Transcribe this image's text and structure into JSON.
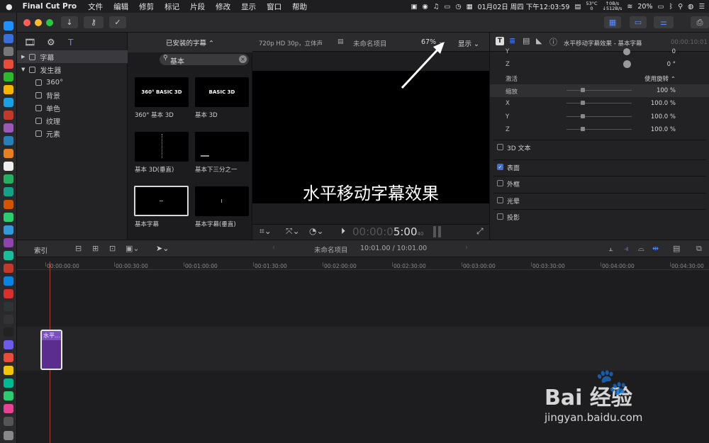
{
  "menubar": {
    "app": "Final Cut Pro",
    "items": [
      "文件",
      "编辑",
      "修剪",
      "标记",
      "片段",
      "修改",
      "显示",
      "窗口",
      "帮助"
    ],
    "datetime": "01月02日 周四 下午12:03:59",
    "battery": "20%",
    "cpu_temp": "53°C",
    "cpu_num": "0",
    "net_up": "↑0B/s",
    "net_down": "↓512B/s"
  },
  "libraries": {
    "dropdown": "已安装的字幕",
    "items": [
      "字幕",
      "发生器",
      "360°",
      "背景",
      "单色",
      "纹理",
      "元素"
    ]
  },
  "browser": {
    "search_value": "基本",
    "thumbs": [
      {
        "label": "360° 基本 3D",
        "preview": "360° BASIC 3D"
      },
      {
        "label": "基本 3D",
        "preview": "BASIC 3D"
      },
      {
        "label": "基本 3D(垂直)",
        "preview": ""
      },
      {
        "label": "基本下三分之一",
        "preview": ""
      },
      {
        "label": "基本字幕",
        "preview": ""
      },
      {
        "label": "基本字幕(垂直)",
        "preview": ""
      }
    ]
  },
  "viewer": {
    "format": "720p HD 30p，立体声",
    "project": "未命名项目",
    "zoom": "67%",
    "display": "显示",
    "caption": "水平移动字幕效果",
    "timecode_dim": "00:00:0",
    "timecode": "5:00",
    "timecode_frames": "40"
  },
  "inspector": {
    "title": "水平移动字幕效果 - 基本字幕",
    "time": "00:00:10:01",
    "rows": [
      {
        "label": "Y",
        "value": "0"
      },
      {
        "label": "Z",
        "value": "0 °"
      },
      {
        "label": "激活",
        "value": "使用旋转"
      },
      {
        "label": "缩放",
        "value": "100 %"
      },
      {
        "label": "X",
        "value": "100.0 %"
      },
      {
        "label": "Y",
        "value": "100.0 %"
      },
      {
        "label": "Z",
        "value": "100.0 %"
      }
    ],
    "sections": [
      {
        "label": "3D 文本",
        "checked": false
      },
      {
        "label": "表面",
        "checked": true
      },
      {
        "label": "外框",
        "checked": false
      },
      {
        "label": "光晕",
        "checked": false
      },
      {
        "label": "投影",
        "checked": false
      }
    ]
  },
  "timelinebar": {
    "index": "索引",
    "project": "未命名项目",
    "duration": "10:01.00 / 10:01.00"
  },
  "timeline": {
    "ticks": [
      "00:00:00:00",
      "00:00:30:00",
      "00:01:00:00",
      "00:01:30:00",
      "00:02:00:00",
      "00:02:30:00",
      "00:03:00:00",
      "00:03:30:00",
      "00:04:00:00",
      "00:04:30:00"
    ],
    "clip_label": "水平..."
  },
  "watermark": {
    "brand": "Bai 经验",
    "url": "jingyan.baidu.com"
  }
}
